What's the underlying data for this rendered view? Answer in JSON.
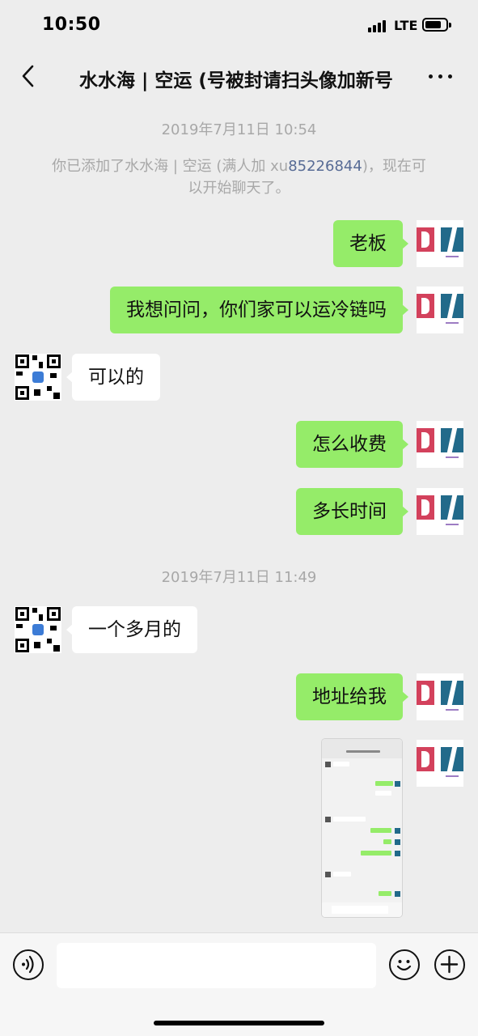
{
  "status_bar": {
    "time": "10:50",
    "network": "LTE"
  },
  "header": {
    "title": "水水海 | 空运 (号被封请扫头像加新号"
  },
  "timestamps": [
    "2019年7月11日 10:54",
    "2019年7月11日 11:49"
  ],
  "system_message": {
    "line1_prefix": "你已添加了水水海 | 空运 (满人加 xu",
    "link_number": "85226844",
    "line1_suffix": ")，现在可",
    "line2": "以开始聊天了。"
  },
  "messages": [
    {
      "side": "right",
      "text": "老板"
    },
    {
      "side": "right",
      "text": "我想问问，你们家可以运冷链吗"
    },
    {
      "side": "left",
      "text": "可以的"
    },
    {
      "side": "right",
      "text": "怎么收费"
    },
    {
      "side": "right",
      "text": "多长时间"
    },
    {
      "side": "left",
      "text": "一个多月的"
    },
    {
      "side": "right",
      "text": "地址给我"
    },
    {
      "side": "right",
      "type": "image"
    }
  ],
  "icons": {
    "back": "chevron-left-icon",
    "more": "more-icon",
    "voice": "voice-icon",
    "emoji": "emoji-icon",
    "plus": "plus-icon"
  },
  "colors": {
    "outgoing_bubble": "#95ec69",
    "incoming_bubble": "#ffffff",
    "background": "#ededed",
    "link": "#576b95"
  }
}
